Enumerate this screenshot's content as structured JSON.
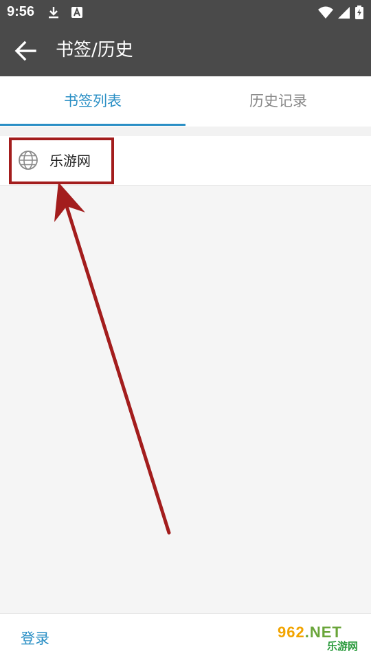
{
  "status_bar": {
    "time": "9:56",
    "icons": [
      "download-icon",
      "keyboard-a-icon",
      "wifi-icon",
      "signal-icon",
      "battery-charging-icon"
    ]
  },
  "app_bar": {
    "title": "书签/历史",
    "back_icon": "arrow-left-icon"
  },
  "tabs": [
    {
      "label": "书签列表",
      "active": true
    },
    {
      "label": "历史记录",
      "active": false
    }
  ],
  "bookmarks": [
    {
      "icon": "globe-icon",
      "label": "乐游网"
    }
  ],
  "bottom_bar": {
    "login_label": "登录"
  },
  "watermark": {
    "number": "962",
    "suffix": ".NET",
    "site": "乐游网"
  },
  "colors": {
    "header": "#4a4a4a",
    "accent": "#2a8fc5",
    "annotation": "#a31d1d"
  }
}
